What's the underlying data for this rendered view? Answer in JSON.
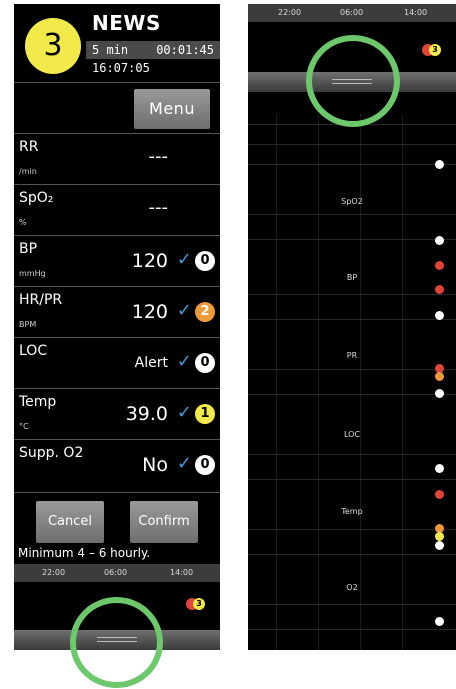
{
  "header": {
    "score": "3",
    "title": "NEWS",
    "frequency": "5 min",
    "timer": "00:01:45",
    "clock": "16:07:05"
  },
  "menu": {
    "label": "Menu"
  },
  "params": [
    {
      "name": "RR",
      "unit": "/min",
      "value": "---"
    },
    {
      "name": "SpO₂",
      "unit": "%",
      "value": "---"
    },
    {
      "name": "BP",
      "unit": "mmHg",
      "value": "120",
      "score": "0"
    },
    {
      "name": "HR/PR",
      "unit": "BPM",
      "value": "120",
      "score": "2"
    },
    {
      "name": "LOC",
      "unit": "",
      "value": "Alert",
      "score": "0"
    },
    {
      "name": "Temp",
      "unit": "°C",
      "value": "39.0",
      "score": "1"
    },
    {
      "name": "Supp. O2",
      "unit": "",
      "value": "No",
      "score": "0"
    }
  ],
  "check_glyph": "✓",
  "actions": {
    "cancel": "Cancel",
    "confirm": "Confirm"
  },
  "frequency_note": "Minimum 4 – 6 hourly.",
  "timeline": {
    "ticks": [
      "22:00",
      "06:00",
      "14:00"
    ]
  },
  "mini_indicator": {
    "score": "3"
  },
  "trend": {
    "labels": [
      "SpO2",
      "BP",
      "PR",
      "LOC",
      "Temp",
      "O2"
    ]
  },
  "colors": {
    "score_yellow": "#f2ea4a",
    "score_orange": "#f09a3a",
    "alert_red": "#e2433a",
    "check_blue": "#3b9bd8",
    "highlight_green": "#6cc86a"
  }
}
